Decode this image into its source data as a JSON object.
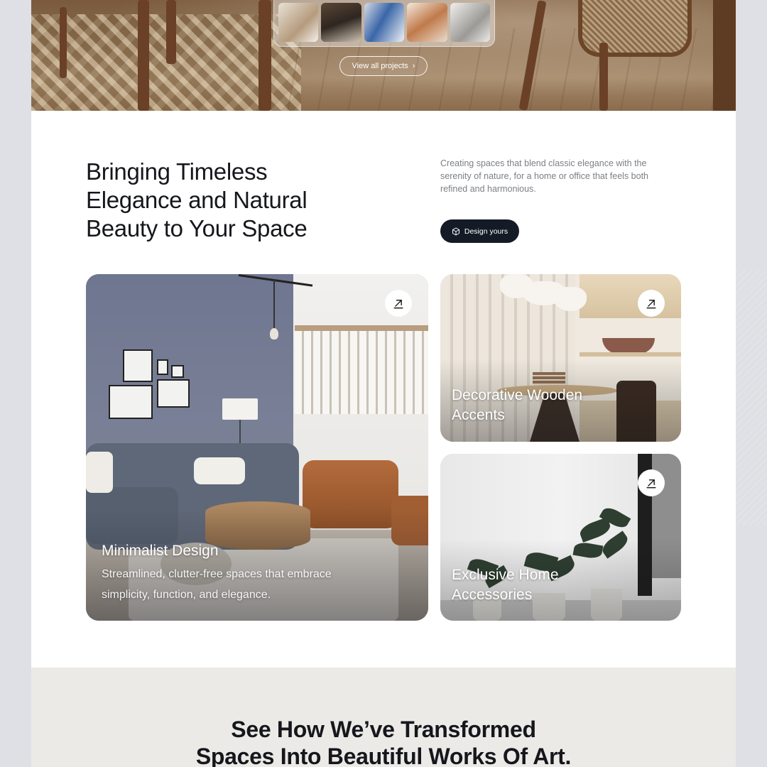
{
  "hero": {
    "view_all_label": "View all projects",
    "view_all_icon": "chevron-right-icon",
    "thumbnails": [
      "project-1",
      "project-2",
      "project-3",
      "project-4",
      "project-5"
    ]
  },
  "intro": {
    "headline_lines": [
      "Bringing Timeless",
      "Elegance and Natural",
      "Beauty to Your Space"
    ],
    "description": "Creating spaces that blend classic elegance with the serenity of nature, for a home or office that feels both refined and harmonious.",
    "cta_label": "Design yours",
    "cta_icon": "cube-icon"
  },
  "cards": [
    {
      "title": "Minimalist Design",
      "description_lines": [
        "Streamlined, clutter-free spaces that embrace",
        "simplicity, function, and elegance."
      ],
      "icon": "arrow-up-right-icon"
    },
    {
      "title_lines": [
        "Decorative Wooden",
        "Accents"
      ],
      "icon": "arrow-up-right-icon"
    },
    {
      "title_lines": [
        "Exclusive Home",
        "Accessories"
      ],
      "icon": "arrow-up-right-icon"
    }
  ],
  "section2": {
    "title_lines": [
      "See How We’ve Transformed",
      "Spaces Into Beautiful Works Of Art."
    ]
  },
  "colors": {
    "page_bg": "#dfe0e5",
    "dark_button": "#141a26",
    "text_dark": "#15171c",
    "text_muted": "#7c7f86",
    "bottom_bg": "#eceae7"
  }
}
